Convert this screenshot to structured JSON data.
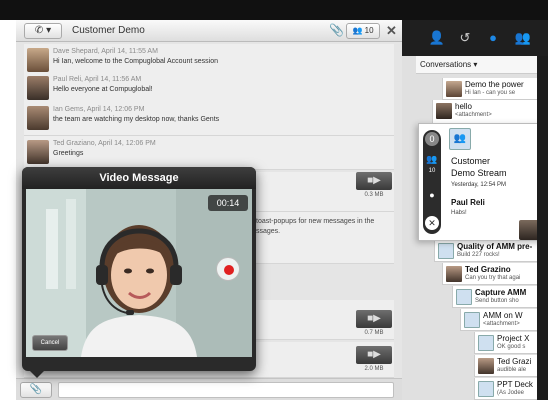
{
  "chat": {
    "title": "Customer Demo",
    "participants": "10",
    "call_icon": "phone-icon",
    "messages": [
      {
        "meta": "Dave Shepard, April 14, 11:55 AM",
        "text": "Hi Ian, welcome to the Compuglobal Account session"
      },
      {
        "meta": "Paul Reli, April 14, 11:56 AM",
        "text": "Hello everyone at Compuglobal!"
      },
      {
        "meta": "Ian Gems, April 14, 12:06 PM",
        "text": "the team are watching my desktop now, thanks Gents"
      },
      {
        "meta": "Ted Graziano, April 14, 12:06 PM",
        "text": "Greetings"
      }
    ],
    "attachments": [
      "0.3 MB",
      "0.7 MB",
      "2.0 MB"
    ],
    "partial_text_1": "toast-popups for new messages in the",
    "partial_text_2": "ssages."
  },
  "video_popup": {
    "title": "Video Message",
    "timer": "00:14",
    "cancel_label": "Cancel"
  },
  "right_panel": {
    "tabs": [
      "contact-icon",
      "history-icon",
      "chat-icon",
      "group-icon"
    ],
    "conversations_label": "Conversations",
    "items": [
      {
        "title": "Demo the power",
        "sub": "Hi Ian - can you se"
      },
      {
        "title": "hello",
        "sub": "<attachment>"
      },
      {
        "title": "Quality of AMM pre-",
        "sub": "Build 227 rocks!"
      },
      {
        "title": "Ted Grazino",
        "sub": "Can you try that agai"
      },
      {
        "title": "Capture AMM",
        "sub": "Send button sho"
      },
      {
        "title": "AMM on W",
        "sub": "<attachment>"
      },
      {
        "title": "Project X",
        "sub": "OK good s"
      },
      {
        "title": "Ted Grazi",
        "sub": "audible ale"
      },
      {
        "title": "PPT Deck",
        "sub": "(As Jodee"
      }
    ],
    "expanded": {
      "title_line1": "Customer",
      "title_line2": "Demo Stream",
      "date": "Yesterday, 12:54 PM",
      "author": "Paul Reli",
      "text": "Habs!",
      "badge_count": "0",
      "people_count": "10"
    }
  },
  "colors": {
    "accent": "#1e88e5",
    "dark_bar": "#111111",
    "recording_red": "#e02020"
  }
}
